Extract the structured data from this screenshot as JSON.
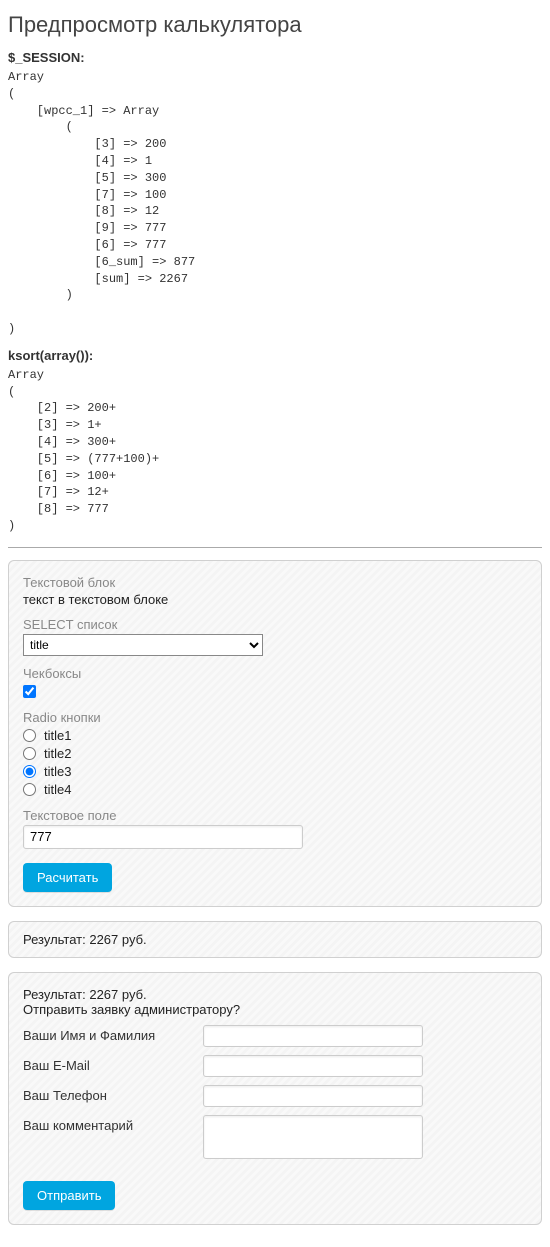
{
  "title": "Предпросмотр калькулятора",
  "debug": {
    "session_label": "$_SESSION:",
    "session_dump": "Array\n(\n    [wpcc_1] => Array\n        (\n            [3] => 200\n            [4] => 1\n            [5] => 300\n            [7] => 100\n            [8] => 12\n            [9] => 777\n            [6] => 777\n            [6_sum] => 877\n            [sum] => 2267\n        )\n\n)",
    "ksort_label": "ksort(array()):",
    "ksort_dump": "Array\n(\n    [2] => 200+\n    [3] => 1+\n    [4] => 300+\n    [5] => (777+100)+\n    [6] => 100+\n    [7] => 12+\n    [8] => 777\n)"
  },
  "calc": {
    "textblock_label": "Текстовой блок",
    "textblock_value": "текст в текстовом блоке",
    "select_label": "SELECT список",
    "select_value": "title",
    "checkbox_label": "Чекбоксы",
    "checkbox_checked": true,
    "radio_label": "Radio кнопки",
    "radio_options": [
      "title1",
      "title2",
      "title3",
      "title4"
    ],
    "radio_selected": "title3",
    "textfield_label": "Текстовое поле",
    "textfield_value": "777",
    "calc_button": "Расчитать"
  },
  "result1": {
    "text": "Результат: 2267 руб."
  },
  "result2": {
    "text": "Результат: 2267 руб.",
    "question": "Отправить заявку администратору?",
    "name_label": "Ваши Имя и Фамилия",
    "name_value": "",
    "email_label": "Ваш E-Mail",
    "email_value": "",
    "phone_label": "Ваш Телефон",
    "phone_value": "",
    "comment_label": "Ваш комментарий",
    "comment_value": "",
    "send_button": "Отправить"
  }
}
